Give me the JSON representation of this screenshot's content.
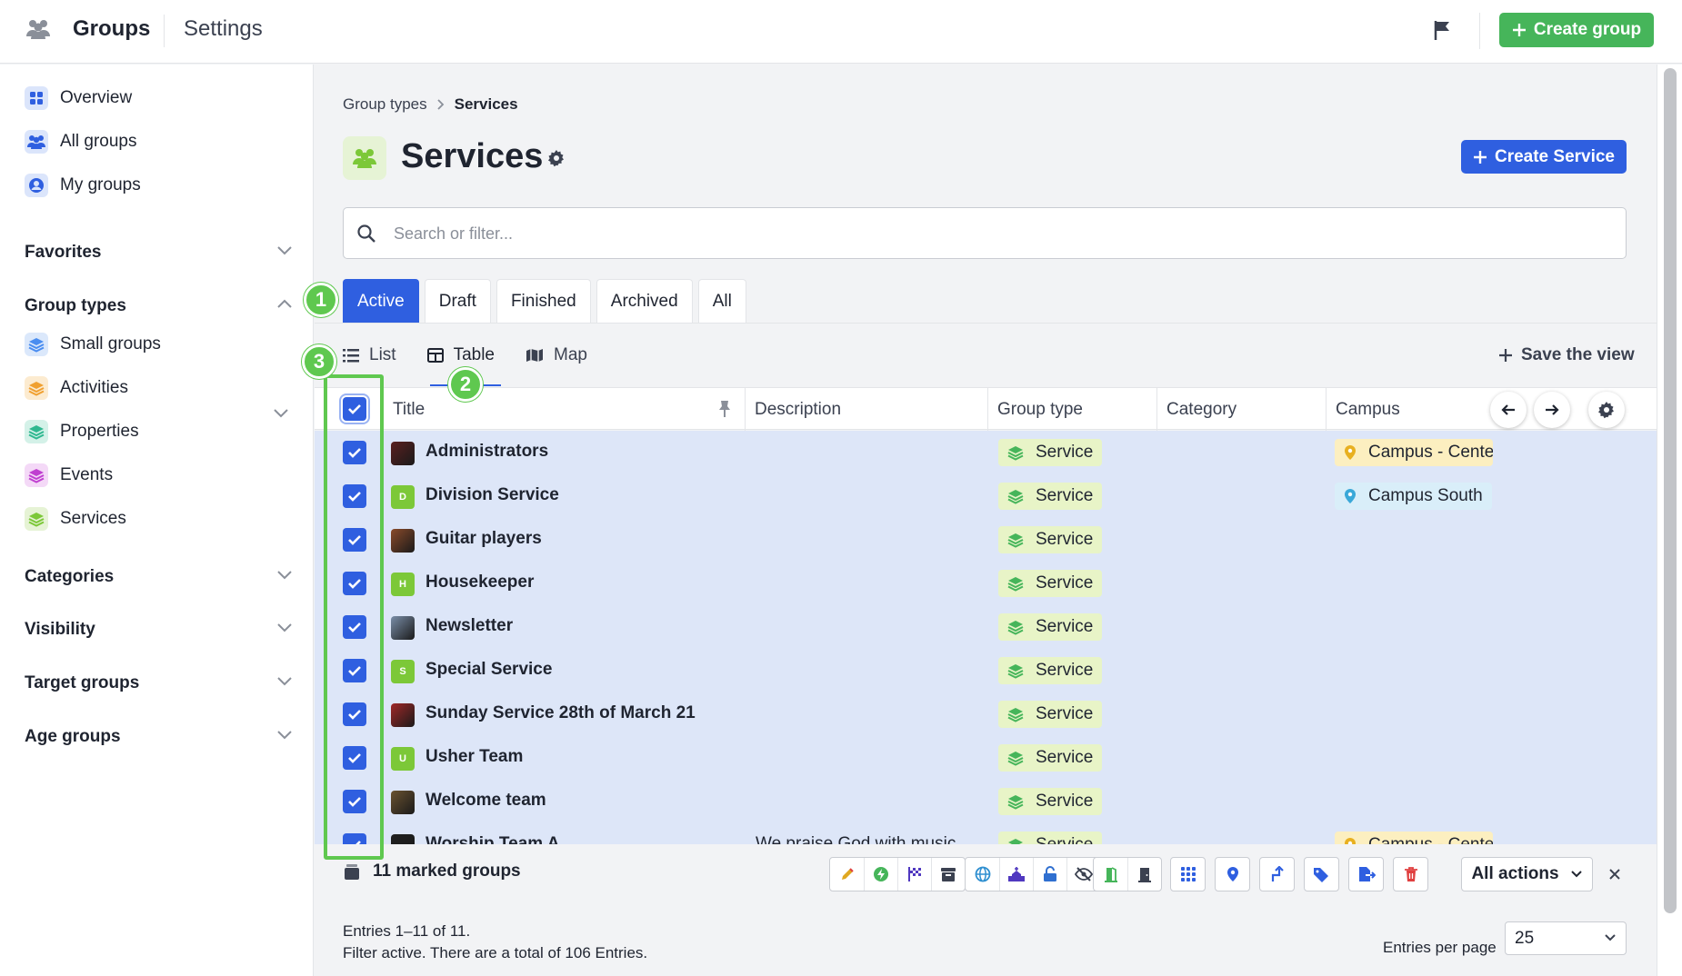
{
  "topbar": {
    "app_title": "Groups",
    "settings_label": "Settings",
    "create_group_label": "Create group",
    "app_icon": "users-icon",
    "flag_icon": "flag-icon"
  },
  "sidebar": {
    "primary": [
      {
        "label": "Overview",
        "icon": "grid-icon"
      },
      {
        "label": "All groups",
        "icon": "users-icon"
      },
      {
        "label": "My groups",
        "icon": "user-circle-icon"
      }
    ],
    "favorites_label": "Favorites",
    "group_types_label": "Group types",
    "group_types": [
      {
        "label": "Small groups",
        "color": "#4a8df0"
      },
      {
        "label": "Activities",
        "color": "#f0a030"
      },
      {
        "label": "Properties",
        "color": "#30b890"
      },
      {
        "label": "Events",
        "color": "#c040d0"
      },
      {
        "label": "Services",
        "color": "#7cc838"
      }
    ],
    "categories_label": "Categories",
    "visibility_label": "Visibility",
    "target_groups_label": "Target groups",
    "age_groups_label": "Age groups"
  },
  "breadcrumb": {
    "parent": "Group types",
    "current": "Services"
  },
  "page": {
    "title": "Services",
    "create_button_label": "Create Service"
  },
  "search": {
    "placeholder": "Search or filter..."
  },
  "tabs": [
    {
      "label": "Active",
      "active": true
    },
    {
      "label": "Draft",
      "active": false
    },
    {
      "label": "Finished",
      "active": false
    },
    {
      "label": "Archived",
      "active": false
    },
    {
      "label": "All",
      "active": false
    }
  ],
  "views": {
    "list_label": "List",
    "table_label": "Table",
    "map_label": "Map",
    "active": "Table",
    "save_view_label": "Save the view"
  },
  "table": {
    "columns": [
      "Title",
      "Description",
      "Group type",
      "Category",
      "Campus"
    ],
    "rows": [
      {
        "title": "Administrators",
        "avatar": "img",
        "avatar_color": "#5a2020",
        "description": "",
        "group_type": "Service",
        "campus": "Campus - Cente",
        "campus_kind": "center"
      },
      {
        "title": "Division Service",
        "avatar": "D",
        "avatar_color": "#7cc838",
        "description": "",
        "group_type": "Service",
        "campus": "Campus South",
        "campus_kind": "south"
      },
      {
        "title": "Guitar players",
        "avatar": "img",
        "avatar_color": "#8a4a2a",
        "description": "",
        "group_type": "Service",
        "campus": "",
        "campus_kind": ""
      },
      {
        "title": "Housekeeper",
        "avatar": "H",
        "avatar_color": "#7cc838",
        "description": "",
        "group_type": "Service",
        "campus": "",
        "campus_kind": ""
      },
      {
        "title": "Newsletter",
        "avatar": "img",
        "avatar_color": "#7a8ea8",
        "description": "",
        "group_type": "Service",
        "campus": "",
        "campus_kind": ""
      },
      {
        "title": "Special Service",
        "avatar": "S",
        "avatar_color": "#7cc838",
        "description": "",
        "group_type": "Service",
        "campus": "",
        "campus_kind": ""
      },
      {
        "title": "Sunday Service 28th of March 21",
        "avatar": "img",
        "avatar_color": "#a02828",
        "description": "",
        "group_type": "Service",
        "campus": "",
        "campus_kind": ""
      },
      {
        "title": "Usher Team",
        "avatar": "U",
        "avatar_color": "#7cc838",
        "description": "",
        "group_type": "Service",
        "campus": "",
        "campus_kind": ""
      },
      {
        "title": "Welcome team",
        "avatar": "img",
        "avatar_color": "#6a5230",
        "description": "",
        "group_type": "Service",
        "campus": "",
        "campus_kind": ""
      },
      {
        "title": "Worship Team A",
        "avatar": "img",
        "avatar_color": "#202020",
        "description": "We praise God with music",
        "group_type": "Service",
        "campus": "Campus - Cente",
        "campus_kind": "center"
      }
    ]
  },
  "actionbar": {
    "marked_label": "11 marked groups",
    "all_actions_label": "All actions"
  },
  "footer": {
    "entries_text": "Entries 1–11 of 11.",
    "filter_text": "Filter active. There are a total of 106 Entries.",
    "per_page_label": "Entries per page",
    "per_page_value": "25"
  },
  "annotations": [
    "1",
    "2",
    "3"
  ],
  "colors": {
    "primary": "#2f5fe0",
    "success": "#46b55a",
    "annotation": "#5fc84f",
    "selected_row": "#dde6f8"
  }
}
